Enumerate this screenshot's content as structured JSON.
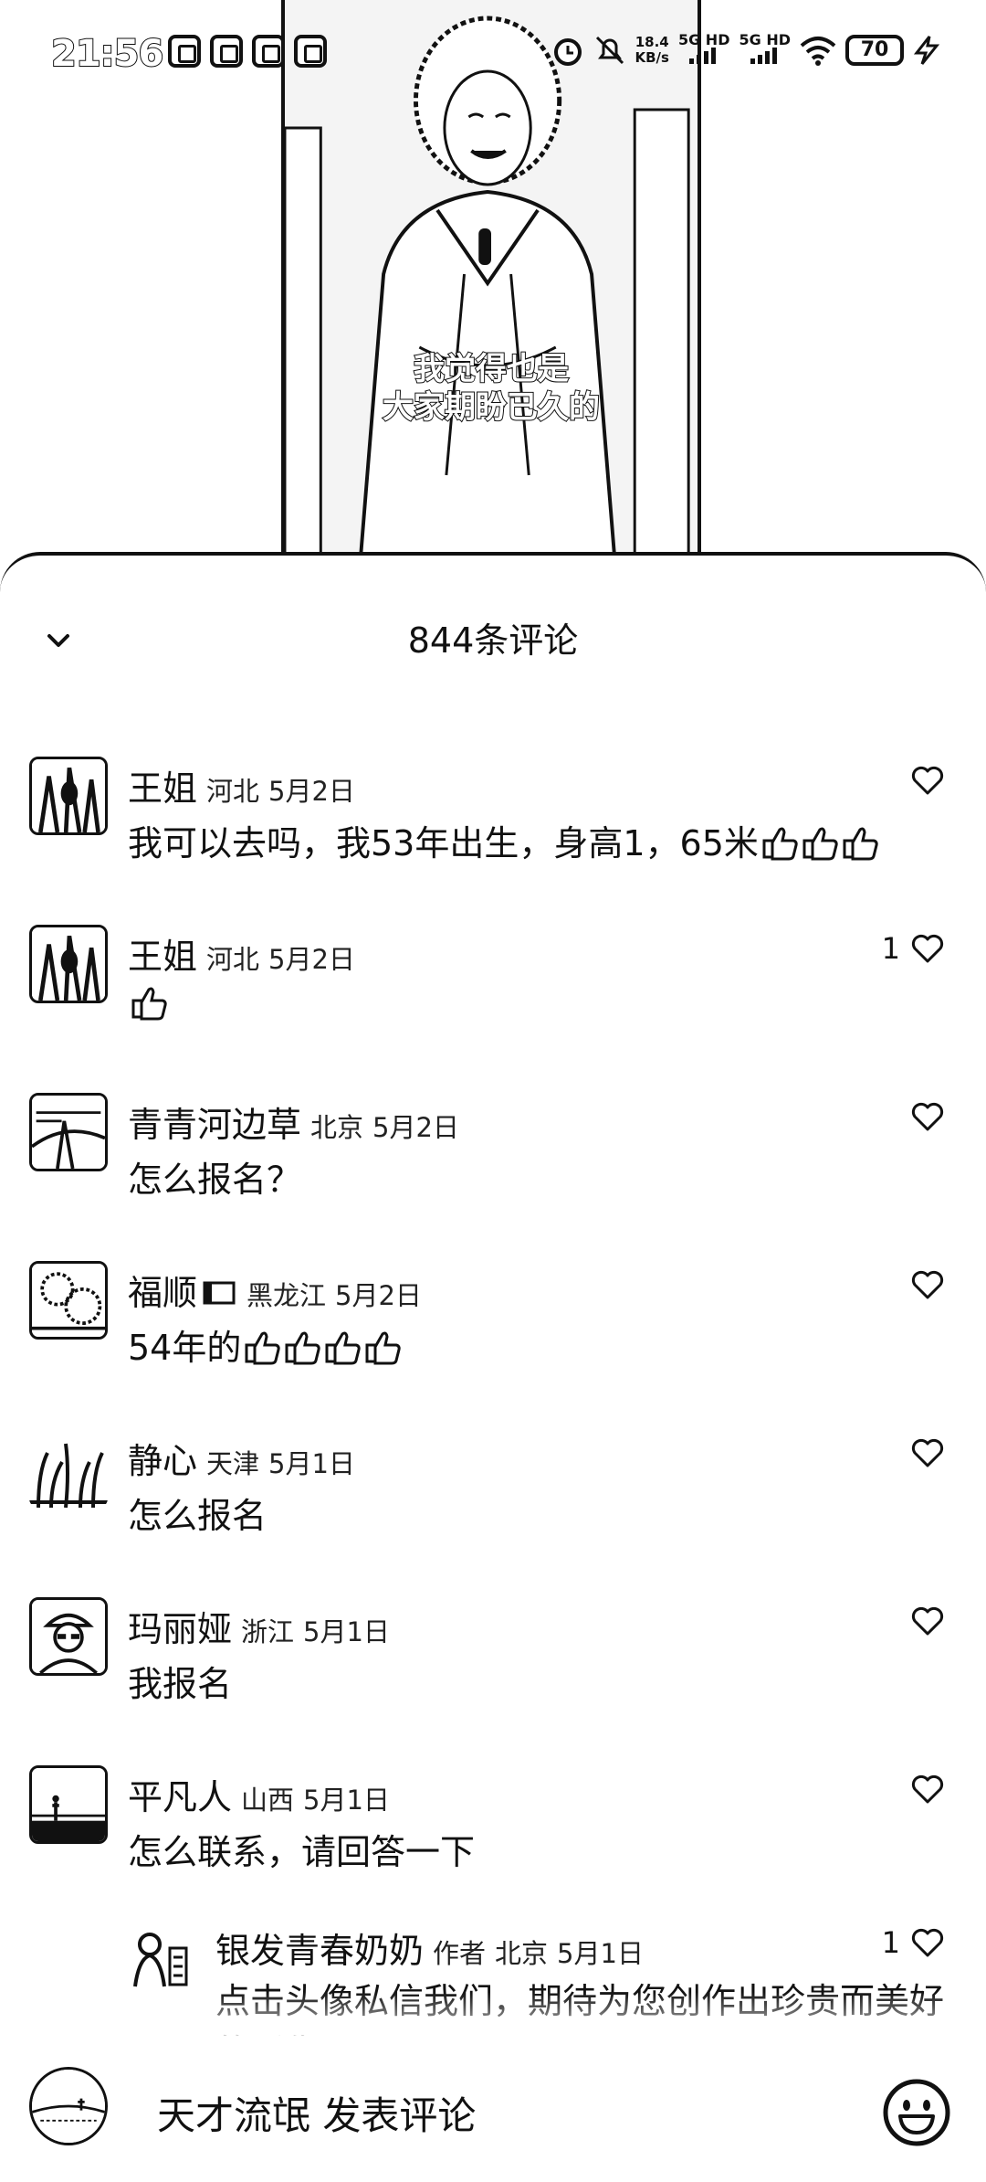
{
  "status_bar": {
    "time": "21:56",
    "net_speed_value": "18.4",
    "net_speed_unit": "KB/s",
    "signal_1": "5G HD",
    "signal_2": "5G HD",
    "battery": "70"
  },
  "video": {
    "subtitle_line1": "我觉得也是",
    "subtitle_line2": "大家期盼已久的"
  },
  "sheet": {
    "title": "844条评论"
  },
  "comments": [
    {
      "name": "王姐",
      "location": "河北",
      "date": "5月2日",
      "text": "我可以去吗，我53年出生，身高1，65米",
      "thumbs": 3,
      "likes": ""
    },
    {
      "name": "王姐",
      "location": "河北",
      "date": "5月2日",
      "text": "",
      "thumbs": 1,
      "likes": "1"
    },
    {
      "name": "青青河边草",
      "location": "北京",
      "date": "5月2日",
      "text": "怎么报名？",
      "thumbs": 0,
      "likes": ""
    },
    {
      "name": "福顺",
      "location": "黑龙江",
      "date": "5月2日",
      "text": "54年的",
      "thumbs": 4,
      "likes": ""
    },
    {
      "name": "静心",
      "location": "天津",
      "date": "5月1日",
      "text": "怎么报名",
      "thumbs": 0,
      "likes": ""
    },
    {
      "name": "玛丽娅",
      "location": "浙江",
      "date": "5月1日",
      "text": "我报名",
      "thumbs": 0,
      "likes": ""
    },
    {
      "name": "平凡人",
      "location": "山西",
      "date": "5月1日",
      "text": "怎么联系，请回答一下",
      "thumbs": 0,
      "likes": ""
    }
  ],
  "reply": {
    "name": "银发青春奶奶",
    "author_tag": "作者",
    "location": "北京",
    "date": "5月1日",
    "text": "点击头像私信我们，期待为您创作出珍贵而美好的影像",
    "likes": "1"
  },
  "bottom_bar": {
    "username": "天才流氓",
    "placeholder": "发表评论"
  },
  "icons": {
    "collapse": "chevron-down-icon",
    "like": "heart-outline-icon",
    "thumb": "thumbs-up-emoji",
    "emoji": "smiley-icon"
  }
}
